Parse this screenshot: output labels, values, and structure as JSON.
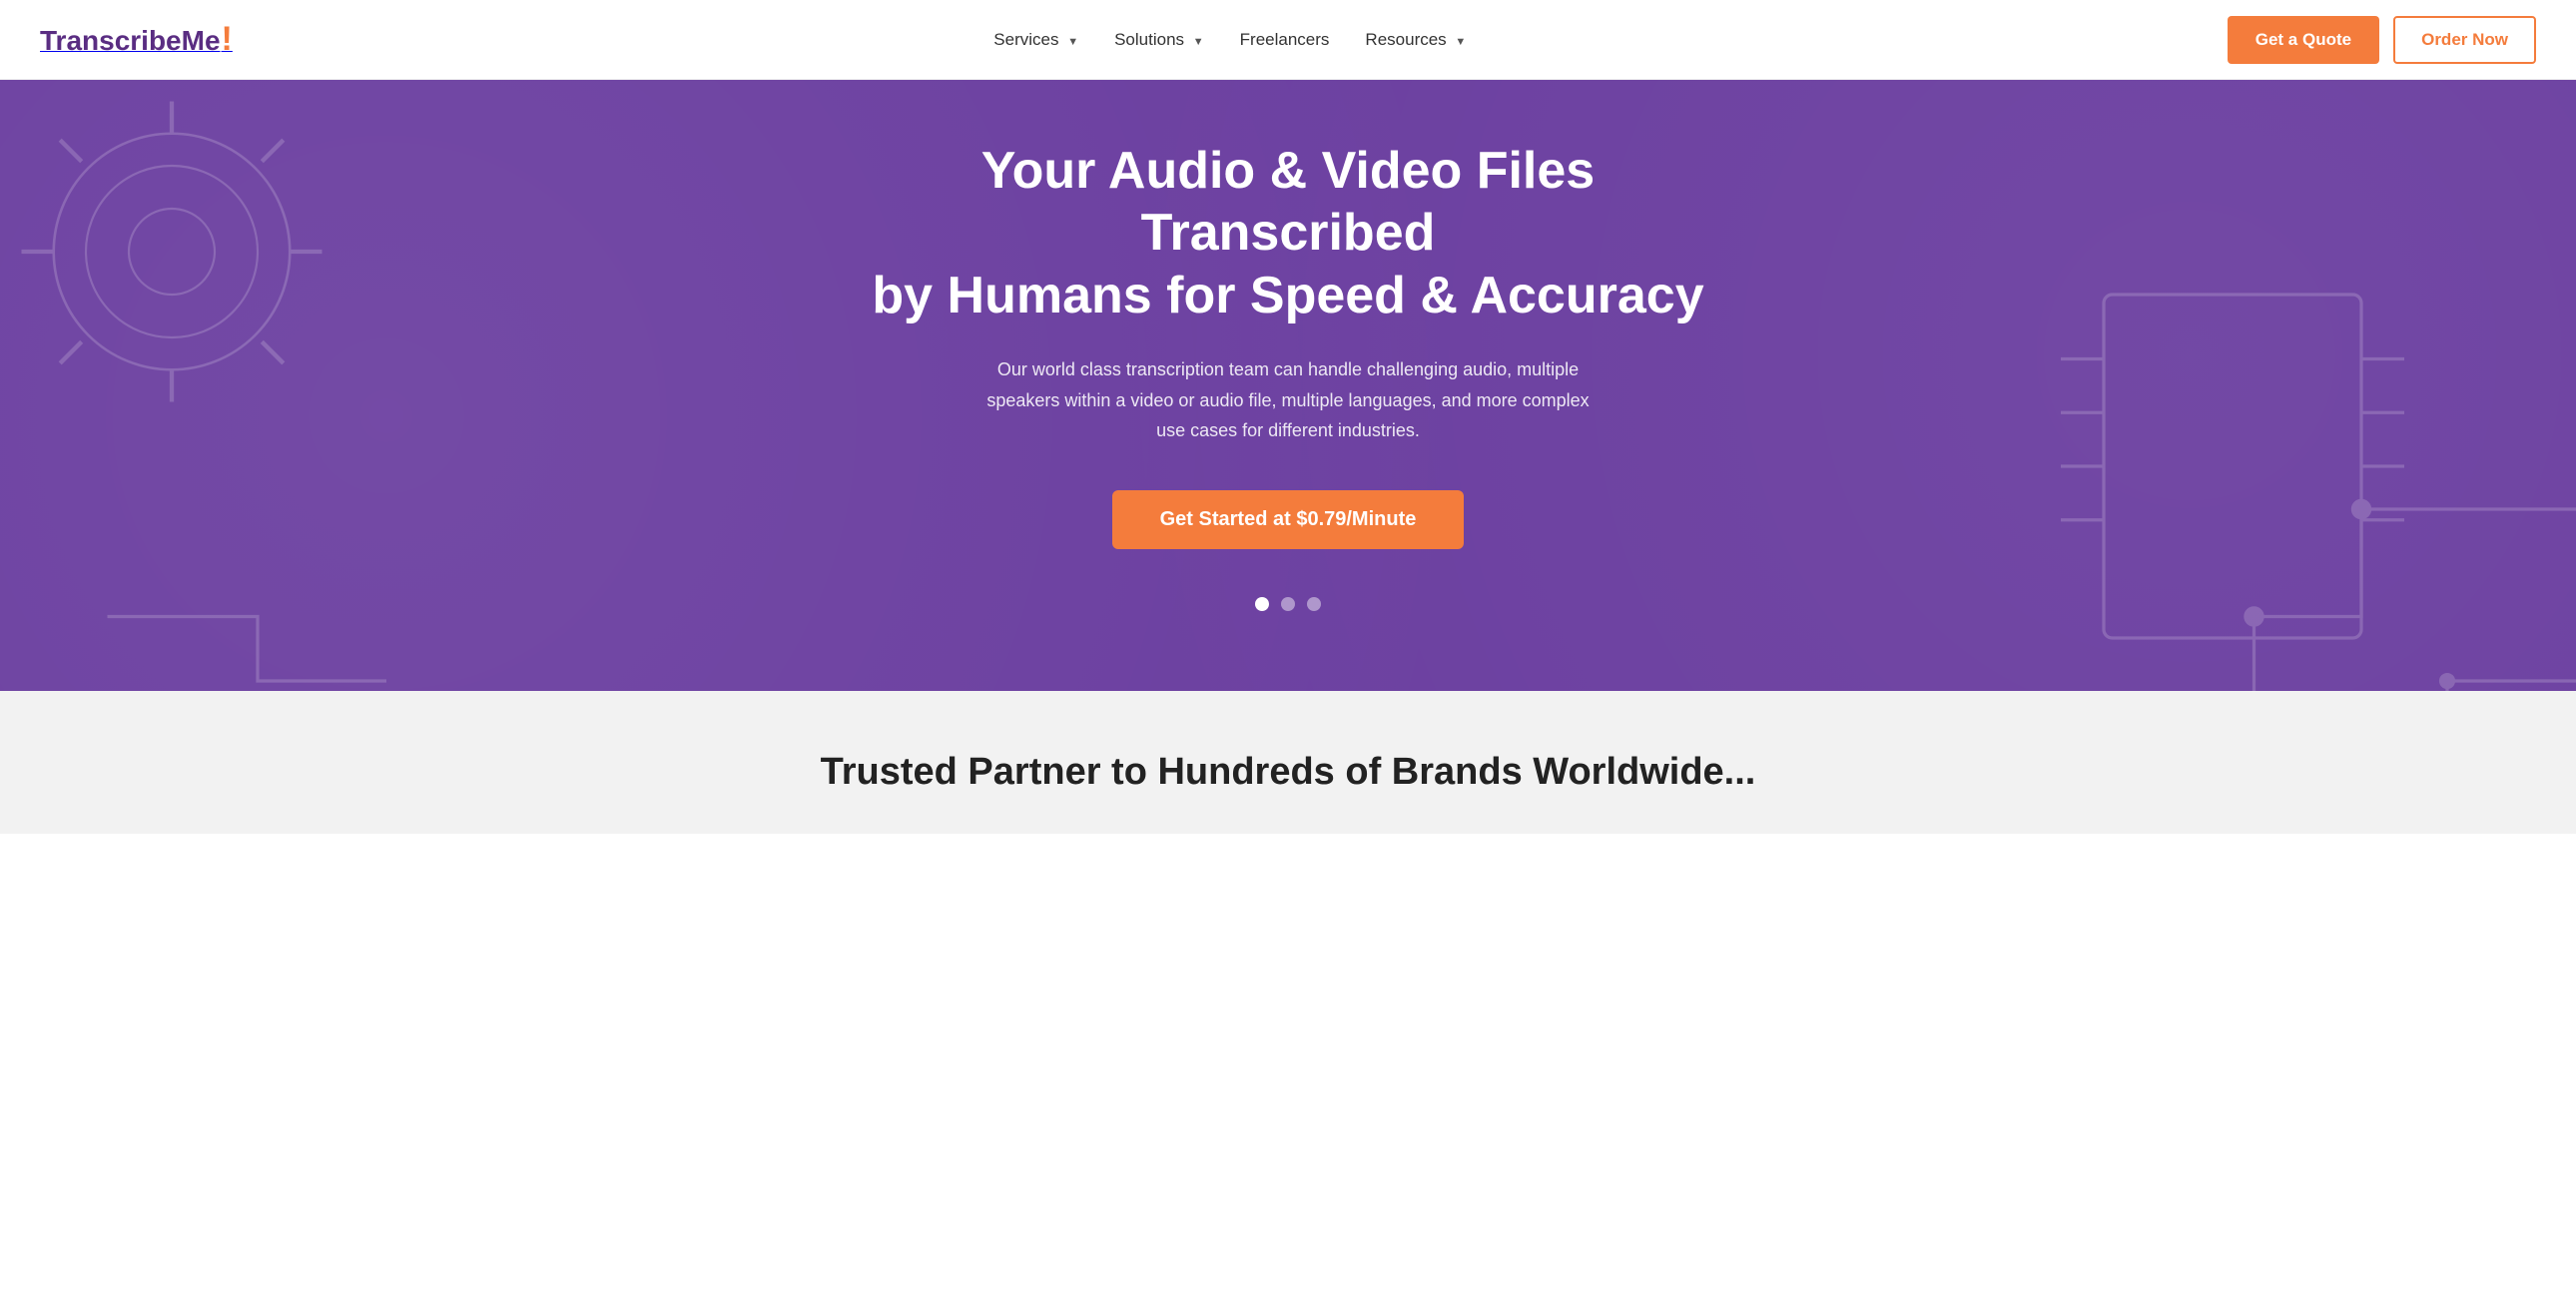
{
  "logo": {
    "text": "TranscribeMe",
    "exclaim": "!"
  },
  "nav": {
    "links": [
      {
        "label": "Services",
        "has_dropdown": true
      },
      {
        "label": "Solutions",
        "has_dropdown": true
      },
      {
        "label": "Freelancers",
        "has_dropdown": false
      },
      {
        "label": "Resources",
        "has_dropdown": true
      }
    ],
    "get_quote_label": "Get a Quote",
    "order_now_label": "Order Now"
  },
  "hero": {
    "heading_line1": "Your Audio & Video Files Transcribed",
    "heading_line2": "by Humans for Speed & Accuracy",
    "subtext": "Our world class transcription team can handle challenging audio, multiple speakers within a video or audio file, multiple languages, and more complex use cases for different industries.",
    "cta_label": "Get Started at $0.79/Minute",
    "dots": [
      {
        "active": true
      },
      {
        "active": false
      },
      {
        "active": false
      }
    ]
  },
  "trusted": {
    "heading": "Trusted Partner to Hundreds of Brands Worldwide..."
  }
}
